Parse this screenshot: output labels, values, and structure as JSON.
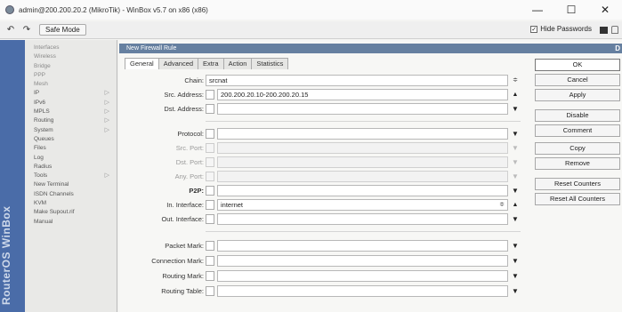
{
  "window": {
    "title": "admin@200.200.20.2 (MikroTik) - WinBox v5.7 on x86 (x86)",
    "minimize": "—",
    "maximize": "☐",
    "close": "✕"
  },
  "toolbar": {
    "undo": "↶",
    "redo": "↷",
    "safe_mode": "Safe Mode",
    "hide_passwords": "Hide Passwords",
    "hide_passwords_checked": true
  },
  "sidebar": {
    "vertical_label": "RouterOS WinBox",
    "items": [
      {
        "label": "Interfaces",
        "submenu": false
      },
      {
        "label": "Wireless",
        "submenu": false
      },
      {
        "label": "Bridge",
        "submenu": false
      },
      {
        "label": "PPP",
        "submenu": false
      },
      {
        "label": "Mesh",
        "submenu": false
      },
      {
        "label": "IP",
        "submenu": true
      },
      {
        "label": "IPv6",
        "submenu": true
      },
      {
        "label": "MPLS",
        "submenu": true
      },
      {
        "label": "Routing",
        "submenu": true
      },
      {
        "label": "System",
        "submenu": true
      },
      {
        "label": "Queues",
        "submenu": false
      },
      {
        "label": "Files",
        "submenu": false
      },
      {
        "label": "Log",
        "submenu": false
      },
      {
        "label": "Radius",
        "submenu": false
      },
      {
        "label": "Tools",
        "submenu": true
      },
      {
        "label": "New Terminal",
        "submenu": false
      },
      {
        "label": "ISDN Channels",
        "submenu": false
      },
      {
        "label": "KVM",
        "submenu": false
      },
      {
        "label": "Make Supout.rif",
        "submenu": false
      },
      {
        "label": "Manual",
        "submenu": false
      }
    ]
  },
  "dialog": {
    "title": "New Firewall Rule",
    "title_right": "D",
    "tabs": [
      "General",
      "Advanced",
      "Extra",
      "Action",
      "Statistics"
    ],
    "active_tab": "General",
    "fields": {
      "chain": {
        "label": "Chain:",
        "value": "srcnat"
      },
      "src_address": {
        "label": "Src. Address:",
        "value": "200.200.20.10-200.200.20.15"
      },
      "dst_address": {
        "label": "Dst. Address:",
        "value": ""
      },
      "protocol": {
        "label": "Protocol:",
        "value": ""
      },
      "src_port": {
        "label": "Src. Port:",
        "value": ""
      },
      "dst_port": {
        "label": "Dst. Port:",
        "value": ""
      },
      "any_port": {
        "label": "Any. Port:",
        "value": ""
      },
      "p2p": {
        "label": "P2P:",
        "value": ""
      },
      "in_interface": {
        "label": "In. Interface:",
        "value": "internet"
      },
      "out_interface": {
        "label": "Out. Interface:",
        "value": ""
      },
      "packet_mark": {
        "label": "Packet Mark:",
        "value": ""
      },
      "connection_mark": {
        "label": "Connection Mark:",
        "value": ""
      },
      "routing_mark": {
        "label": "Routing Mark:",
        "value": ""
      },
      "routing_table": {
        "label": "Routing Table:",
        "value": ""
      }
    },
    "actions": {
      "ok": "OK",
      "cancel": "Cancel",
      "apply": "Apply",
      "disable": "Disable",
      "comment": "Comment",
      "copy": "Copy",
      "remove": "Remove",
      "reset_counters": "Reset Counters",
      "reset_all_counters": "Reset All Counters"
    }
  },
  "glyphs": {
    "dropdown": "▼",
    "up": "▲",
    "dropdown_small": "≑",
    "submenu_arrow": "▷"
  },
  "colors": {
    "sidebar_strip": "#4a6ca8",
    "dialog_title_bar": "#6680a0"
  }
}
